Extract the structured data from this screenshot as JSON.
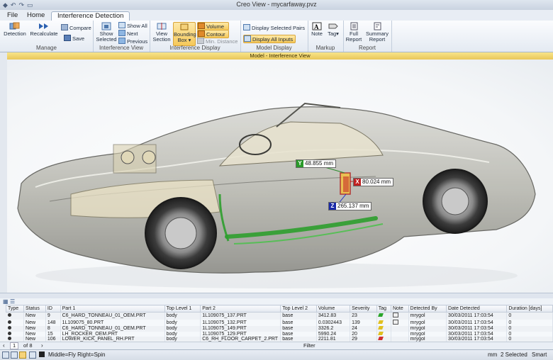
{
  "window": {
    "title": "Creo View - mycarfaway.pvz"
  },
  "menu": {
    "file": "File",
    "tabs": [
      "Home",
      "Interference Detection"
    ]
  },
  "ribbon": {
    "manage": {
      "label": "Manage",
      "detection": "Detection",
      "recalculate": "Recalculate",
      "compare": "Compare",
      "save": "Save"
    },
    "interference_view": {
      "label": "Interference View",
      "show_selected": "Show Selected",
      "show_all": "Show All",
      "next": "Next",
      "previous": "Previous"
    },
    "interference_display": {
      "label": "Interference Display",
      "view_section": "View Section",
      "bounding_box": "Bounding Box",
      "volume": "Volume",
      "contour": "Contour",
      "min_distance": "Min. Distance"
    },
    "model_display": {
      "label": "Model Display",
      "display_selected_pairs": "Display Selected Pairs",
      "display_all_inputs": "Display All Inputs"
    },
    "markup": {
      "label": "Markup",
      "note": "Note",
      "tag": "Tag"
    },
    "report": {
      "label": "Report",
      "full_report": "Full Report",
      "summary_report": "Summary Report"
    }
  },
  "viewport": {
    "header": "Model - Interference View",
    "measurements": {
      "x": "80.024 mm",
      "y": "48.855 mm",
      "z": "265.137 mm"
    },
    "axis_letters": {
      "x": "X",
      "y": "Y",
      "z": "Z"
    }
  },
  "grid": {
    "columns": [
      "Type",
      "Status",
      "ID",
      "Part 1",
      "Top Level 1",
      "Part 2",
      "Top Level 2",
      "Volume",
      "Severity",
      "Tag",
      "Note",
      "Detected By",
      "Date Detected",
      "Duration [days]"
    ],
    "rows": [
      [
        "",
        "New",
        "9",
        "C6_HARD_TONNEAU_01_OEM.PRT",
        "body",
        "1L109075_137.PRT",
        "base",
        "3412.83",
        "23",
        "",
        "",
        "mrygol",
        "30/03/2011 17:03:54",
        "0"
      ],
      [
        "",
        "New",
        "148",
        "1L109075_80.PRT",
        "body",
        "1L109075_132.PRT",
        "base",
        "0.0302443",
        "139",
        "",
        "",
        "mrygol",
        "30/03/2011 17:03:54",
        "0"
      ],
      [
        "",
        "New",
        "8",
        "C6_HARD_TONNEAU_01_OEM.PRT",
        "body",
        "1L109075_149.PRT",
        "base",
        "3326.2",
        "24",
        "",
        "",
        "mrygol",
        "30/03/2011 17:03:54",
        "0"
      ],
      [
        "",
        "New",
        "15",
        "LH_ROCKER_OEM.PRT",
        "body",
        "1L109075_129.PRT",
        "base",
        "5990.24",
        "20",
        "",
        "",
        "mrygol",
        "30/03/2011 17:03:54",
        "0"
      ],
      [
        "",
        "New",
        "106",
        "LOWER_KICK_PANEL_RH.PRT",
        "body",
        "C6_RH_FLOOR_CARPET_2.PRT",
        "base",
        "2211.81",
        "29",
        "",
        "",
        "mrygol",
        "30/03/2011 17:03:54",
        "0"
      ]
    ],
    "tag_colors": [
      "#2aa52a",
      "#e0c020",
      "#e0c020",
      "#e0c020",
      "#d03030"
    ]
  },
  "pager": {
    "page": "1",
    "of": "of 8",
    "filter": "Filter"
  },
  "status": {
    "hint": "Middle=Fly  Right=Spin",
    "units": "mm",
    "selected": "2 Selected",
    "mode": "Smart"
  },
  "colors": {
    "accent": "#f6c95a",
    "ribbon": "#e4eaf2",
    "select_green": "#3aa33a"
  }
}
